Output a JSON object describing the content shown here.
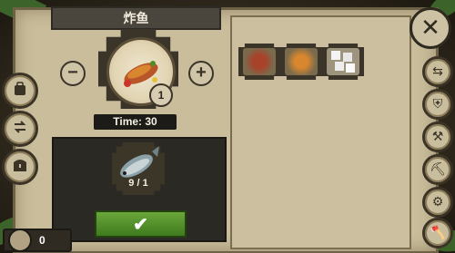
{
  "dialog": {
    "title": "炸鱼"
  },
  "recipe": {
    "dish_icon": "fried-fish-plate",
    "quantity": "1",
    "time_label": "Time: 30"
  },
  "ingredient": {
    "icon": "raw-fish",
    "count": "9 / 1"
  },
  "buttons": {
    "minus": "−",
    "plus": "+",
    "confirm": "✔",
    "close": "✕"
  },
  "result_slots": [
    {
      "icon": "steak-plate-icon"
    },
    {
      "icon": "fried-fish-plate-icon"
    },
    {
      "icon": "sugar-cubes-icon"
    }
  ],
  "left_menu": [
    {
      "icon": "backpack-icon"
    },
    {
      "icon": "transfer-arrows-icon"
    },
    {
      "icon": "chest-icon"
    }
  ],
  "right_menu": [
    {
      "icon": "refresh-arrows-icon"
    },
    {
      "icon": "armor-icon"
    },
    {
      "icon": "hammer-icon"
    },
    {
      "icon": "pickaxe-icon"
    },
    {
      "icon": "anvil-icon"
    },
    {
      "icon": "axe-icon"
    }
  ],
  "currency": {
    "value": "0"
  },
  "colors": {
    "panel": "#c9bd9b",
    "confirm_green": "#4f8f27",
    "dark": "#2b2923"
  }
}
